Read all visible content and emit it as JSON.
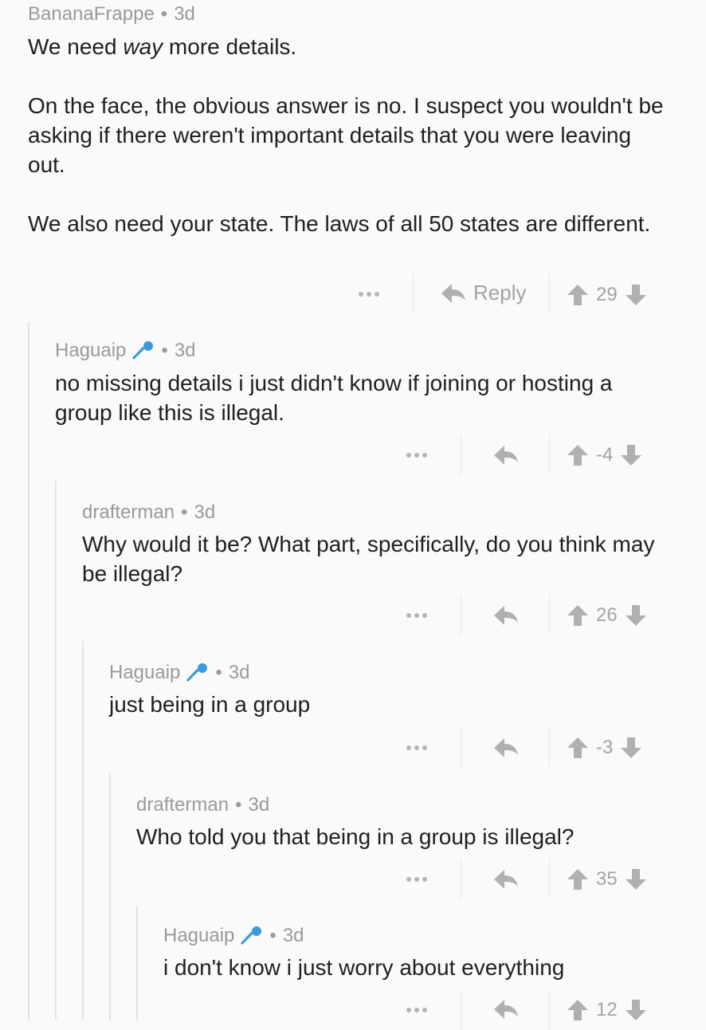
{
  "comments": [
    {
      "author": "BananaFrappe",
      "age": "3d",
      "has_flair": false,
      "paragraphs": [
        [
          "We need ",
          "way",
          " more details."
        ],
        [
          "On the face, the obvious answer is no. I suspect you wouldn't be asking if there weren't important details that you were leaving out."
        ],
        [
          "We also need your state. The laws of all 50 states are different."
        ]
      ],
      "reply_label": "Reply",
      "score": "29"
    },
    {
      "author": "Haguaip",
      "age": "3d",
      "has_flair": true,
      "text": "no missing details i just didn't know if joining or hosting a group like this is illegal.",
      "score": "-4"
    },
    {
      "author": "drafterman",
      "age": "3d",
      "has_flair": false,
      "text": "Why would it be? What part, specifically, do you think may be illegal?",
      "score": "26"
    },
    {
      "author": "Haguaip",
      "age": "3d",
      "has_flair": true,
      "text": "just being in a group",
      "score": "-3"
    },
    {
      "author": "drafterman",
      "age": "3d",
      "has_flair": false,
      "text": "Who told you that being in a group is illegal?",
      "score": "35"
    },
    {
      "author": "Haguaip",
      "age": "3d",
      "has_flair": true,
      "text": "i don't know i just worry about everything",
      "score": "12"
    }
  ],
  "meta_separator": "•",
  "colors": {
    "flair": "#3a9ad9",
    "muted": "#9a9a9a",
    "thread_line": "#e4e4e4"
  },
  "icons": {
    "flair": "microphone-icon",
    "reply": "reply-arrow-icon",
    "upvote": "upvote-arrow-icon",
    "downvote": "downvote-arrow-icon",
    "more": "more-dots-icon"
  }
}
